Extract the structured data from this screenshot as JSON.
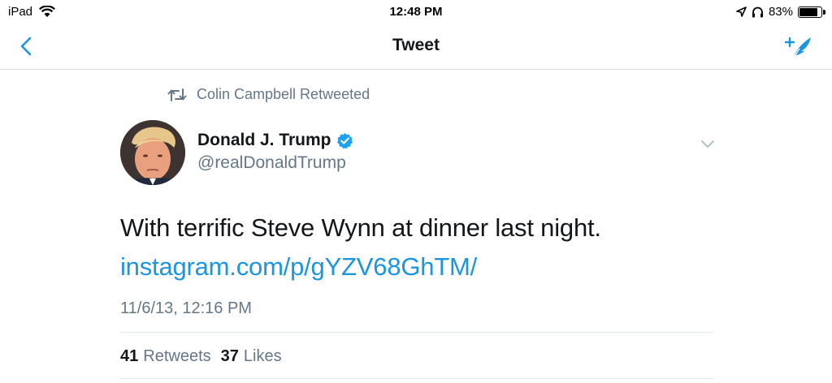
{
  "status_bar": {
    "device": "iPad",
    "time": "12:48 PM",
    "battery": "83%",
    "battery_level": 0.83,
    "icons": [
      "wifi-icon",
      "location-icon",
      "headphones-icon",
      "battery-icon"
    ]
  },
  "nav": {
    "title": "Tweet",
    "back_icon": "chevron-left-icon",
    "compose_icon": "compose-tweet-icon"
  },
  "colors": {
    "accent": "#1b95e0",
    "text": "#14171a",
    "secondary": "#657786",
    "verified": "#1da1f2",
    "divider": "#e1e8ed"
  },
  "tweet": {
    "retweeted_by": "Colin Campbell Retweeted",
    "author_name": "Donald J. Trump",
    "author_handle": "@realDonaldTrump",
    "verified": true,
    "text": "With terrific Steve Wynn at dinner last night.",
    "link": "instagram.com/p/gYZV68GhTM/",
    "timestamp": "11/6/13, 12:16 PM",
    "retweets_count": "41",
    "retweets_label": "Retweets",
    "likes_count": "37",
    "likes_label": "Likes"
  }
}
